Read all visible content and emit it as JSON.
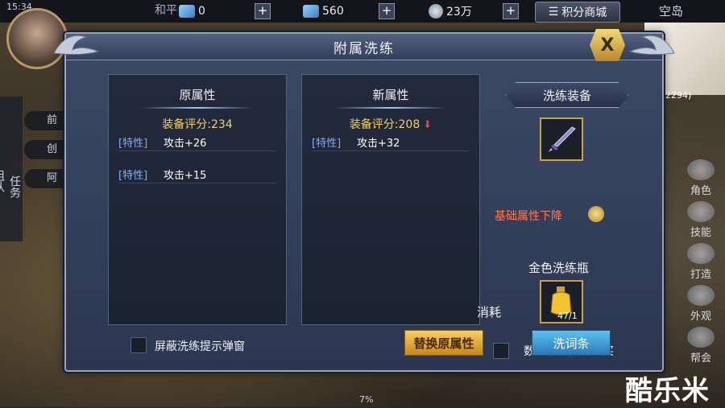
{
  "status_bar": {
    "time": "15:34"
  },
  "top": {
    "server": "和平",
    "gems": "0",
    "crystals": "560",
    "silver": "23万",
    "shop_label": "积分商城",
    "map_name": "空岛",
    "coordinates": "2294)"
  },
  "left": {
    "quest_tab": "任务",
    "team_tab": "组队",
    "items": [
      "前",
      "创",
      "阿"
    ]
  },
  "right_menu": [
    "角色",
    "技能",
    "打造",
    "外观",
    "帮会"
  ],
  "dialog": {
    "title": "附属洗练",
    "close_label": "X",
    "original": {
      "header": "原属性",
      "score": "装备评分:234",
      "attributes": [
        {
          "tag": "[特性]",
          "value": "攻击+26"
        },
        {
          "tag": "[特性]",
          "value": "攻击+15"
        }
      ]
    },
    "new": {
      "header": "新属性",
      "score": "装备评分:208",
      "score_change": "down",
      "score_change_glyph": "⬇",
      "attributes": [
        {
          "tag": "[特性]",
          "value": "攻击+32"
        }
      ]
    },
    "equip_button": "洗练装备",
    "warning": "基础属性下降",
    "bottle_name": "金色洗练瓶",
    "consume_label": "消耗",
    "bottle_count": "47/1",
    "auto_buy_label": "数量不足自动购买",
    "shield_popup_label": "屏蔽洗练提示弹窗",
    "replace_button": "替换原属性",
    "wash_button": "洗词条"
  },
  "bottom": {
    "percent": "7%"
  },
  "watermark": "酷乐米",
  "colors": {
    "score_gold": "#f0d16c",
    "warning": "#ff7a55",
    "tag_blue": "#7fb0ff",
    "replace_btn": "#e4a53a",
    "wash_btn": "#3b98d4"
  }
}
